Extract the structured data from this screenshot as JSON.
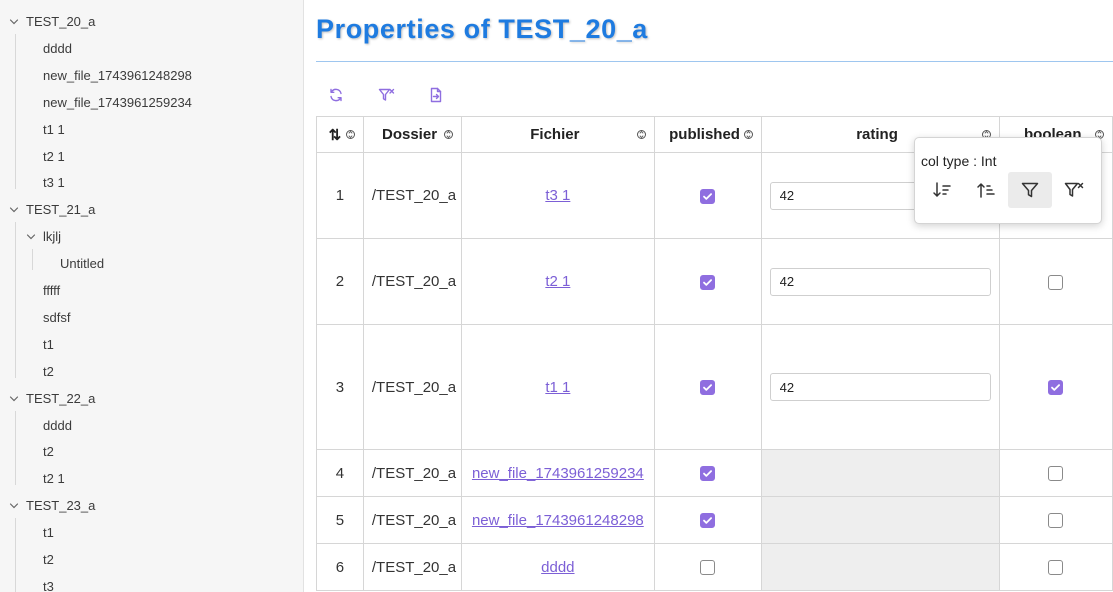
{
  "sidebar": {
    "folders": [
      {
        "label": "TEST_20_a",
        "items": [
          {
            "label": "dddd"
          },
          {
            "label": "new_file_1743961248298"
          },
          {
            "label": "new_file_1743961259234"
          },
          {
            "label": "t1 1"
          },
          {
            "label": "t2 1"
          },
          {
            "label": "t3 1"
          }
        ]
      },
      {
        "label": "TEST_21_a",
        "items": [
          {
            "label": "lkjlj",
            "children": [
              {
                "label": "Untitled"
              }
            ]
          },
          {
            "label": "fffff"
          },
          {
            "label": "sdfsf"
          },
          {
            "label": "t1"
          },
          {
            "label": "t2"
          }
        ]
      },
      {
        "label": "TEST_22_a",
        "items": [
          {
            "label": "dddd"
          },
          {
            "label": "t2"
          },
          {
            "label": "t2 1"
          }
        ]
      },
      {
        "label": "TEST_23_a",
        "items": [
          {
            "label": "t1"
          },
          {
            "label": "t2"
          },
          {
            "label": "t3"
          }
        ]
      }
    ]
  },
  "main": {
    "title": "Properties of TEST_20_a",
    "toolbar": {
      "icons": [
        "refresh-icon",
        "clear-filter-icon",
        "export-icon"
      ]
    },
    "table": {
      "columns": [
        {
          "label": "⇅"
        },
        {
          "label": "Dossier"
        },
        {
          "label": "Fichier"
        },
        {
          "label": "published"
        },
        {
          "label": "rating"
        },
        {
          "label": "boolean"
        }
      ],
      "rows": [
        {
          "index": "1",
          "dossier": "/TEST_20_a",
          "fichier": "t3 1",
          "published": true,
          "rating": "42",
          "boolean": false
        },
        {
          "index": "2",
          "dossier": "/TEST_20_a",
          "fichier": "t2 1",
          "published": true,
          "rating": "42",
          "boolean": false
        },
        {
          "index": "3",
          "dossier": "/TEST_20_a",
          "fichier": "t1 1",
          "published": true,
          "rating": "42",
          "boolean": true
        },
        {
          "index": "4",
          "dossier": "/TEST_20_a",
          "fichier": "new_file_1743961259234",
          "published": true,
          "rating": null,
          "boolean": false
        },
        {
          "index": "5",
          "dossier": "/TEST_20_a",
          "fichier": "new_file_1743961248298",
          "published": true,
          "rating": null,
          "boolean": false
        },
        {
          "index": "6",
          "dossier": "/TEST_20_a",
          "fichier": "dddd",
          "published": false,
          "rating": null,
          "boolean": false
        }
      ]
    },
    "column_popup": {
      "type_text": "col type : Int",
      "buttons": [
        "sort-descending-icon",
        "sort-ascending-icon",
        "filter-icon",
        "clear-filter-icon"
      ],
      "active_button": "filter-icon"
    }
  },
  "colors": {
    "title": "#1e7be0",
    "accent": "#8f6ee0",
    "link": "#7c5fd6"
  }
}
